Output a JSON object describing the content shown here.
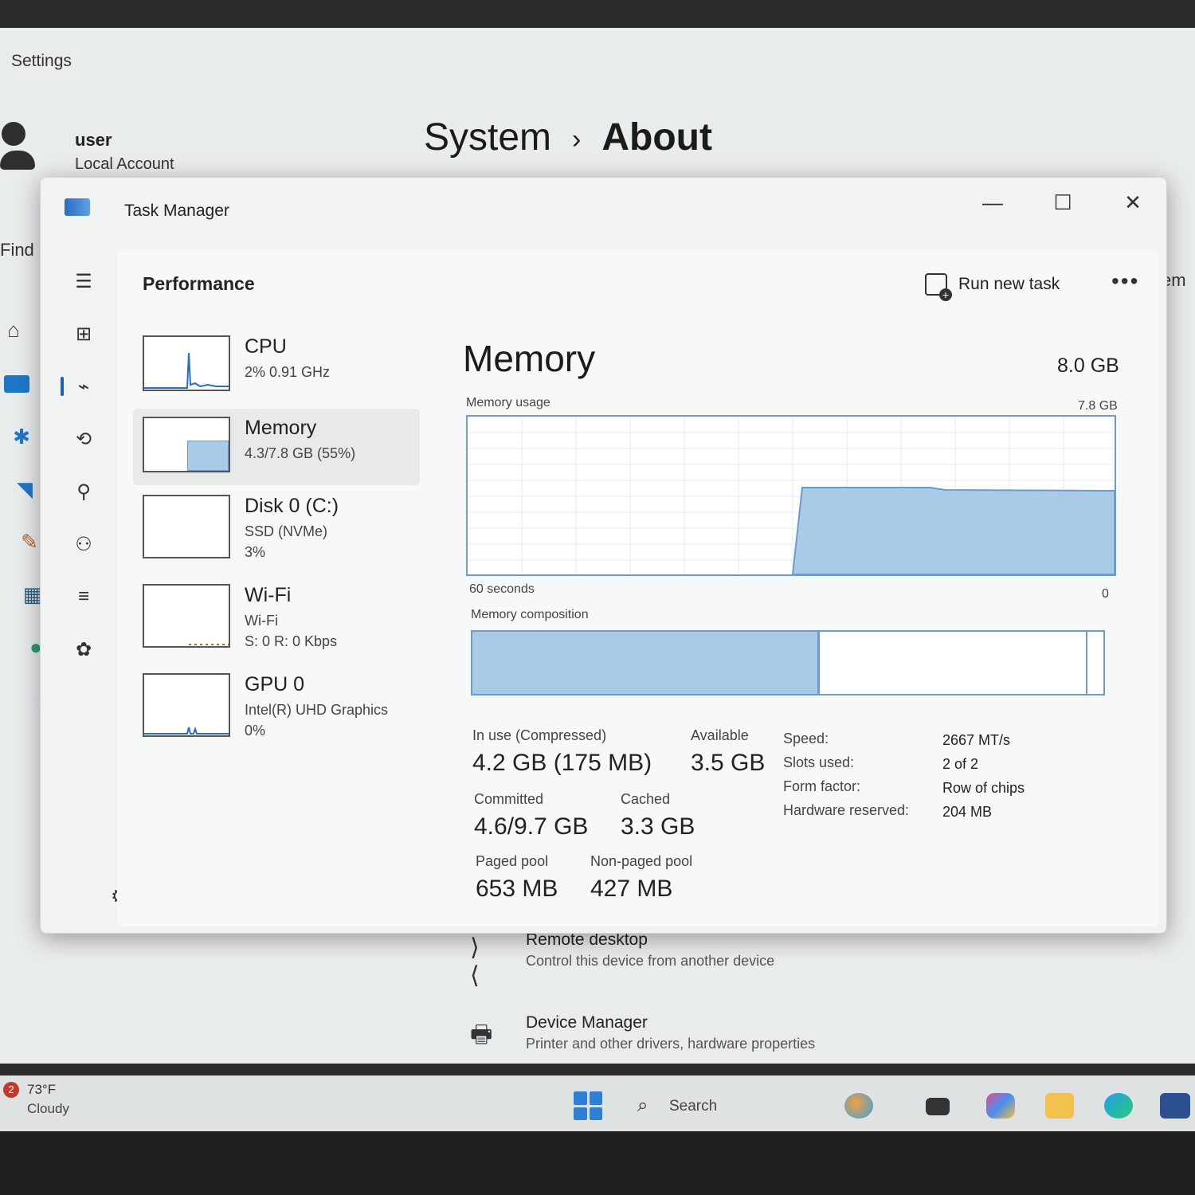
{
  "settings": {
    "window_title": "Settings",
    "user_name": "user",
    "account_type": "Local Account",
    "breadcrumb": {
      "parent": "System",
      "separator": "›",
      "current": "About"
    },
    "search_partial": "Find a",
    "right_partial": "em",
    "nav_icons": [
      "home-icon",
      "system-icon",
      "bluetooth-icon",
      "wifi-icon",
      "personalization-icon",
      "apps-icon",
      "accounts-icon",
      "time-language-icon",
      "gaming-icon",
      "accessibility-icon",
      "privacy-icon",
      "windows-update-icon"
    ],
    "rows": [
      {
        "title": "Remote desktop",
        "subtitle": "Control this device from another device",
        "icon": "remote-desktop-icon"
      },
      {
        "title": "Device Manager",
        "subtitle": "Printer and other drivers, hardware properties",
        "icon": "device-manager-icon"
      }
    ]
  },
  "task_manager": {
    "title": "Task Manager",
    "controls": {
      "minimize": "—",
      "maximize": "☐",
      "close": "✕"
    },
    "page_title": "Performance",
    "run_new_task": "Run new task",
    "more": "•••",
    "devices": [
      {
        "name": "CPU",
        "line1": "2% 0.91 GHz",
        "line2": "",
        "selected": false
      },
      {
        "name": "Memory",
        "line1": "4.3/7.8 GB (55%)",
        "line2": "",
        "selected": true
      },
      {
        "name": "Disk 0 (C:)",
        "line1": "SSD (NVMe)",
        "line2": "3%",
        "selected": false
      },
      {
        "name": "Wi-Fi",
        "line1": "Wi-Fi",
        "line2": "S: 0 R: 0 Kbps",
        "selected": false
      },
      {
        "name": "GPU 0",
        "line1": "Intel(R) UHD Graphics",
        "line2": "0%",
        "selected": false
      }
    ],
    "memory": {
      "heading": "Memory",
      "total": "8.0 GB",
      "usage_label": "Memory usage",
      "usage_max": "7.8 GB",
      "time_span": "60 seconds",
      "time_end": "0",
      "composition_label": "Memory composition",
      "in_use_fraction": 0.55,
      "stats": {
        "in_use_label": "In use (Compressed)",
        "in_use_value": "4.2 GB (175 MB)",
        "available_label": "Available",
        "available_value": "3.5 GB",
        "committed_label": "Committed",
        "committed_value": "4.6/9.7 GB",
        "cached_label": "Cached",
        "cached_value": "3.3 GB",
        "paged_label": "Paged pool",
        "paged_value": "653 MB",
        "nonpaged_label": "Non-paged pool",
        "nonpaged_value": "427 MB"
      },
      "specs": [
        {
          "label": "Speed:",
          "value": "2667 MT/s"
        },
        {
          "label": "Slots used:",
          "value": "2 of 2"
        },
        {
          "label": "Form factor:",
          "value": "Row of chips"
        },
        {
          "label": "Hardware reserved:",
          "value": "204 MB"
        }
      ]
    }
  },
  "taskbar": {
    "weather_badge": "2",
    "weather_temp": "73°F",
    "weather_condition": "Cloudy",
    "search_label": "Search",
    "colors": {
      "accent": "#2e7fd6",
      "graph_fill": "#a9cbe8",
      "graph_border": "#6d9ccc"
    }
  }
}
